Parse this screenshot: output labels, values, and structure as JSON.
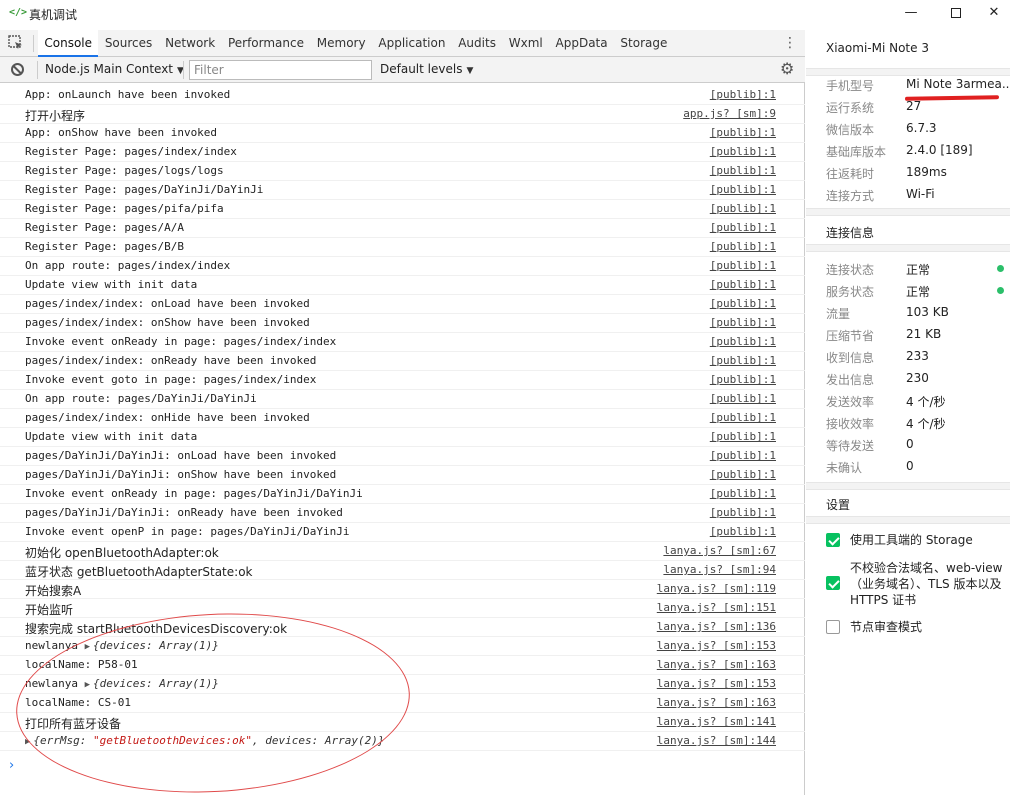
{
  "window": {
    "title": "真机调试",
    "app_icon": "</>",
    "minimize": "—",
    "maximize": "",
    "close": "✕"
  },
  "tabs": [
    {
      "label": "Console",
      "active": true
    },
    {
      "label": "Sources",
      "active": false
    },
    {
      "label": "Network",
      "active": false
    },
    {
      "label": "Performance",
      "active": false
    },
    {
      "label": "Memory",
      "active": false
    },
    {
      "label": "Application",
      "active": false
    },
    {
      "label": "Audits",
      "active": false
    },
    {
      "label": "Wxml",
      "active": false
    },
    {
      "label": "AppData",
      "active": false
    },
    {
      "label": "Storage",
      "active": false
    }
  ],
  "toolbar": {
    "context": "Node.js Main Context",
    "filter_placeholder": "Filter",
    "levels": "Default levels"
  },
  "logs": [
    {
      "msg": "App: onLaunch have been invoked",
      "src": "[publib]:1"
    },
    {
      "msg": "打开小程序",
      "src": "app.js? [sm]:9"
    },
    {
      "msg": "App: onShow have been invoked",
      "src": "[publib]:1"
    },
    {
      "msg": "Register Page: pages/index/index",
      "src": "[publib]:1"
    },
    {
      "msg": "Register Page: pages/logs/logs",
      "src": "[publib]:1"
    },
    {
      "msg": "Register Page: pages/DaYinJi/DaYinJi",
      "src": "[publib]:1"
    },
    {
      "msg": "Register Page: pages/pifa/pifa",
      "src": "[publib]:1"
    },
    {
      "msg": "Register Page: pages/A/A",
      "src": "[publib]:1"
    },
    {
      "msg": "Register Page: pages/B/B",
      "src": "[publib]:1"
    },
    {
      "msg": "On app route: pages/index/index",
      "src": "[publib]:1"
    },
    {
      "msg": "Update view with init data",
      "src": "[publib]:1"
    },
    {
      "msg": "pages/index/index: onLoad have been invoked",
      "src": "[publib]:1"
    },
    {
      "msg": "pages/index/index: onShow have been invoked",
      "src": "[publib]:1"
    },
    {
      "msg": "Invoke event onReady in page: pages/index/index",
      "src": "[publib]:1"
    },
    {
      "msg": "pages/index/index: onReady have been invoked",
      "src": "[publib]:1"
    },
    {
      "msg": "Invoke event goto in page: pages/index/index",
      "src": "[publib]:1"
    },
    {
      "msg": "On app route: pages/DaYinJi/DaYinJi",
      "src": "[publib]:1"
    },
    {
      "msg": "pages/index/index: onHide have been invoked",
      "src": "[publib]:1"
    },
    {
      "msg": "Update view with init data",
      "src": "[publib]:1"
    },
    {
      "msg": "pages/DaYinJi/DaYinJi: onLoad have been invoked",
      "src": "[publib]:1"
    },
    {
      "msg": "pages/DaYinJi/DaYinJi: onShow have been invoked",
      "src": "[publib]:1"
    },
    {
      "msg": "Invoke event onReady in page: pages/DaYinJi/DaYinJi",
      "src": "[publib]:1"
    },
    {
      "msg": "pages/DaYinJi/DaYinJi: onReady have been invoked",
      "src": "[publib]:1"
    },
    {
      "msg": "Invoke event openP in page: pages/DaYinJi/DaYinJi",
      "src": "[publib]:1"
    },
    {
      "msg": "初始化 openBluetoothAdapter:ok",
      "src": "lanya.js? [sm]:67"
    },
    {
      "msg": "蓝牙状态 getBluetoothAdapterState:ok",
      "src": "lanya.js? [sm]:94"
    },
    {
      "msg": "开始搜索A",
      "src": "lanya.js? [sm]:119"
    },
    {
      "msg": "开始监听",
      "src": "lanya.js? [sm]:151"
    },
    {
      "msg": "搜索完成 startBluetoothDevicesDiscovery:ok",
      "src": "lanya.js? [sm]:136"
    },
    {
      "msg": "newlanya ",
      "obj": "{devices: Array(1)}",
      "src": "lanya.js? [sm]:153"
    },
    {
      "msg": "localName: P58-01",
      "src": "lanya.js? [sm]:163"
    },
    {
      "msg": "newlanya ",
      "obj": "{devices: Array(1)}",
      "src": "lanya.js? [sm]:153"
    },
    {
      "msg": "localName: CS-01",
      "src": "lanya.js? [sm]:163"
    },
    {
      "msg": "打印所有蓝牙设备",
      "src": "lanya.js? [sm]:141"
    },
    {
      "msg": "",
      "obj_prefix": "{errMsg: ",
      "obj_str": "\"getBluetoothDevices:ok\"",
      "obj_suffix": ", devices: Array(2)}",
      "src": "lanya.js? [sm]:144"
    }
  ],
  "prompt": "›",
  "device": {
    "name": "Xiaomi-Mi Note 3",
    "info": [
      {
        "k": "手机型号",
        "v": "Mi Note 3armea..."
      },
      {
        "k": "运行系统",
        "v": "27"
      },
      {
        "k": "微信版本",
        "v": "6.7.3"
      },
      {
        "k": "基础库版本",
        "v": "2.4.0 [189]"
      },
      {
        "k": "往返耗时",
        "v": "189ms"
      },
      {
        "k": "连接方式",
        "v": "Wi-Fi"
      }
    ]
  },
  "connection": {
    "title": "连接信息",
    "items": [
      {
        "k": "连接状态",
        "v": "正常",
        "dot": true
      },
      {
        "k": "服务状态",
        "v": "正常",
        "dot": true
      },
      {
        "k": "流量",
        "v": "103 KB"
      },
      {
        "k": "压缩节省",
        "v": "21 KB"
      },
      {
        "k": "收到信息",
        "v": "233"
      },
      {
        "k": "发出信息",
        "v": "230"
      },
      {
        "k": "发送效率",
        "v": "4 个/秒"
      },
      {
        "k": "接收效率",
        "v": "4 个/秒"
      },
      {
        "k": "等待发送",
        "v": "0"
      },
      {
        "k": "未确认",
        "v": "0"
      }
    ]
  },
  "settings": {
    "title": "设置",
    "options": [
      {
        "label": "使用工具端的 Storage",
        "checked": true
      },
      {
        "label": "不校验合法域名、web-view（业务域名）、TLS 版本以及 HTTPS 证书",
        "checked": true
      },
      {
        "label": "节点审查模式",
        "checked": false
      }
    ]
  },
  "colors": {
    "accent": "#1a73e8",
    "status_ok": "#2bbf6a",
    "checkbox": "#07c160",
    "annotation": "#e04a4a"
  }
}
